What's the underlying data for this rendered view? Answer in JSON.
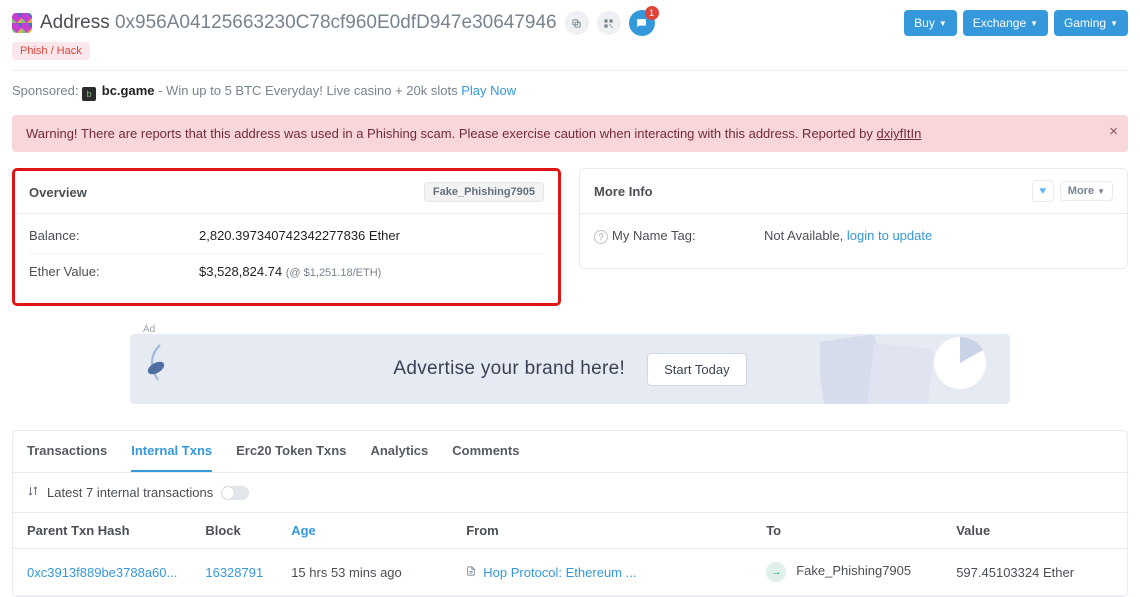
{
  "header": {
    "title_label": "Address",
    "address_hex": "0x956A04125663230C78cf960E0dfD947e30647946",
    "chat_badge": "1",
    "phish_badge": "Phish / Hack",
    "buttons": {
      "buy": "Buy",
      "exchange": "Exchange",
      "gaming": "Gaming"
    }
  },
  "sponsored": {
    "label": "Sponsored:",
    "brand": "bc.game",
    "text": " - Win up to 5 BTC Everyday! Live casino + 20k slots ",
    "cta": "Play Now"
  },
  "warning": {
    "text": "Warning! There are reports that this address was used in a Phishing scam. Please exercise caution when interacting with this address. Reported by ",
    "reporter": "dxiyfItIn"
  },
  "overview": {
    "title": "Overview",
    "tag": "Fake_Phishing7905",
    "balance_label": "Balance:",
    "balance_value": "2,820.397340742342277836 Ether",
    "ethervalue_label": "Ether Value:",
    "ethervalue_value": "$3,528,824.74",
    "ethervalue_rate": "(@ $1,251.18/ETH)"
  },
  "moreinfo": {
    "title": "More Info",
    "more_label": "More",
    "name_tag_label": "My Name Tag:",
    "name_tag_value": "Not Available, ",
    "name_tag_link": "login to update"
  },
  "ad": {
    "label": "Ad",
    "text": "Advertise your brand here!",
    "cta": "Start Today"
  },
  "tabs": [
    "Transactions",
    "Internal Txns",
    "Erc20 Token Txns",
    "Analytics",
    "Comments"
  ],
  "tx": {
    "summary": "Latest 7 internal transactions",
    "columns": {
      "parent": "Parent Txn Hash",
      "block": "Block",
      "age": "Age",
      "from": "From",
      "to": "To",
      "value": "Value"
    },
    "rows": [
      {
        "hash": "0xc3913f889be3788a60...",
        "block": "16328791",
        "age": "15 hrs 53 mins ago",
        "from": "Hop Protocol: Ethereum ...",
        "to": "Fake_Phishing7905",
        "value": "597.45103324 Ether"
      }
    ]
  }
}
